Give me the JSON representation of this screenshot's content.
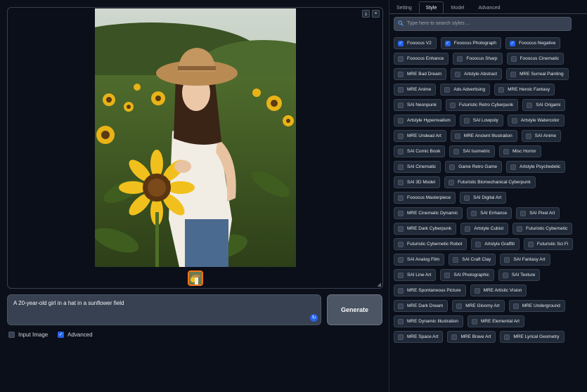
{
  "gallery": {
    "download_icon": "⤓",
    "close_icon": "×",
    "image_alt": "Woman in a straw hat holding a sunflower in a sunflower field"
  },
  "prompt": {
    "value": "A 20-year-old girl in a hat in a sunflower field"
  },
  "generate_label": "Generate",
  "options": {
    "input_image_label": "Input Image",
    "input_image_checked": false,
    "advanced_label": "Advanced",
    "advanced_checked": true
  },
  "tabs": [
    {
      "label": "Setting",
      "active": false
    },
    {
      "label": "Style",
      "active": true
    },
    {
      "label": "Model",
      "active": false
    },
    {
      "label": "Advanced",
      "active": false
    }
  ],
  "search": {
    "placeholder": "Type here to search styles ..."
  },
  "styles": [
    {
      "label": "Fooocus V2",
      "checked": true
    },
    {
      "label": "Fooocus Photograph",
      "checked": true
    },
    {
      "label": "Fooocus Negative",
      "checked": true
    },
    {
      "label": "Fooocus Enhance",
      "checked": false
    },
    {
      "label": "Fooocus Sharp",
      "checked": false
    },
    {
      "label": "Fooocus Cinematic",
      "checked": false
    },
    {
      "label": "MRE Bad Dream",
      "checked": false
    },
    {
      "label": "Artstyle Abstract",
      "checked": false
    },
    {
      "label": "MRE Surreal Painting",
      "checked": false
    },
    {
      "label": "MRE Anime",
      "checked": false
    },
    {
      "label": "Ads Advertising",
      "checked": false
    },
    {
      "label": "MRE Heroic Fantasy",
      "checked": false
    },
    {
      "label": "SAI Neonpunk",
      "checked": false
    },
    {
      "label": "Futuristic Retro Cyberpunk",
      "checked": false
    },
    {
      "label": "SAI Origami",
      "checked": false
    },
    {
      "label": "Artstyle Hyperrealism",
      "checked": false
    },
    {
      "label": "SAI Lowpoly",
      "checked": false
    },
    {
      "label": "Artstyle Watercolor",
      "checked": false
    },
    {
      "label": "MRE Undead Art",
      "checked": false
    },
    {
      "label": "MRE Ancient Illustration",
      "checked": false
    },
    {
      "label": "SAI Anime",
      "checked": false
    },
    {
      "label": "SAI Comic Book",
      "checked": false
    },
    {
      "label": "SAI Isometric",
      "checked": false
    },
    {
      "label": "Misc Horror",
      "checked": false
    },
    {
      "label": "SAI Cinematic",
      "checked": false
    },
    {
      "label": "Game Retro Game",
      "checked": false
    },
    {
      "label": "Artstyle Psychedelic",
      "checked": false
    },
    {
      "label": "SAI 3D Model",
      "checked": false
    },
    {
      "label": "Futuristic Biomechanical Cyberpunk",
      "checked": false
    },
    {
      "label": "Fooocus Masterpiece",
      "checked": false
    },
    {
      "label": "SAI Digital Art",
      "checked": false
    },
    {
      "label": "MRE Cinematic Dynamic",
      "checked": false
    },
    {
      "label": "SAI Enhance",
      "checked": false
    },
    {
      "label": "SAI Pixel Art",
      "checked": false
    },
    {
      "label": "MRE Dark Cyberpunk",
      "checked": false
    },
    {
      "label": "Artstyle Cubist",
      "checked": false
    },
    {
      "label": "Futuristic Cybernetic",
      "checked": false
    },
    {
      "label": "Futuristic Cybernetic Robot",
      "checked": false
    },
    {
      "label": "Artstyle Graffiti",
      "checked": false
    },
    {
      "label": "Futuristic Sci Fi",
      "checked": false
    },
    {
      "label": "SAI Analog Film",
      "checked": false
    },
    {
      "label": "SAI Craft Clay",
      "checked": false
    },
    {
      "label": "SAI Fantasy Art",
      "checked": false
    },
    {
      "label": "SAI Line Art",
      "checked": false
    },
    {
      "label": "SAI Photographic",
      "checked": false
    },
    {
      "label": "SAI Texture",
      "checked": false
    },
    {
      "label": "MRE Spontaneous Picture",
      "checked": false
    },
    {
      "label": "MRE Artistic Vision",
      "checked": false
    },
    {
      "label": "MRE Dark Dream",
      "checked": false
    },
    {
      "label": "MRE Gloomy Art",
      "checked": false
    },
    {
      "label": "MRE Underground",
      "checked": false
    },
    {
      "label": "MRE Dynamic Illustration",
      "checked": false
    },
    {
      "label": "MRE Elemental Art",
      "checked": false
    },
    {
      "label": "MRE Space Art",
      "checked": false
    },
    {
      "label": "MRE Brave Art",
      "checked": false
    },
    {
      "label": "MRE Lyrical Geometry",
      "checked": false
    }
  ],
  "colors": {
    "background": "#0b0f19",
    "accent": "#2563eb",
    "panel": "#1f2937",
    "thumb_border": "#f97316"
  }
}
